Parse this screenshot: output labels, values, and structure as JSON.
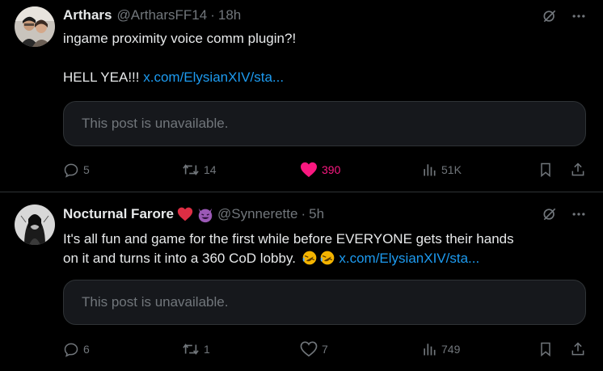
{
  "colors": {
    "background": "#000000",
    "text": "#e7e9ea",
    "muted": "#71767b",
    "link": "#1d9bf0",
    "like": "#f91880",
    "card": "#16181c",
    "border": "#2f3336"
  },
  "posts": [
    {
      "author": "Arthars",
      "handle": "@ArtharsFF14",
      "dot": "·",
      "time": "18h",
      "text_line1": "ingame proximity voice comm plugin?!",
      "text_line3_prefix": "HELL YEA!!! ",
      "link": "x.com/ElysianXIV/sta...",
      "quote_text": "This post is unavailable.",
      "replies": "5",
      "reposts": "14",
      "likes": "390",
      "liked": true,
      "views": "51K",
      "icons": [
        "grok-icon",
        "more-icon",
        "reply-icon",
        "repost-icon",
        "like-icon",
        "views-icon",
        "bookmark-icon",
        "share-icon"
      ]
    },
    {
      "author": "Nocturnal Farore",
      "name_emojis": [
        "red-heart-emoji",
        "smiling-devil-emoji"
      ],
      "handle": "@Synnerette",
      "dot": "·",
      "time": "5h",
      "text_line1": "It's all fun and game for the first while before EVERYONE gets their hands",
      "text_line2_prefix": "on it and turns it into a 360 CoD lobby. ",
      "text_emojis": [
        "rolling-laughing-emoji",
        "rolling-laughing-emoji"
      ],
      "link": "x.com/ElysianXIV/sta...",
      "quote_text": "This post is unavailable.",
      "replies": "6",
      "reposts": "1",
      "likes": "7",
      "liked": false,
      "views": "749",
      "icons": [
        "grok-icon",
        "more-icon",
        "reply-icon",
        "repost-icon",
        "like-icon",
        "views-icon",
        "bookmark-icon",
        "share-icon"
      ]
    }
  ]
}
